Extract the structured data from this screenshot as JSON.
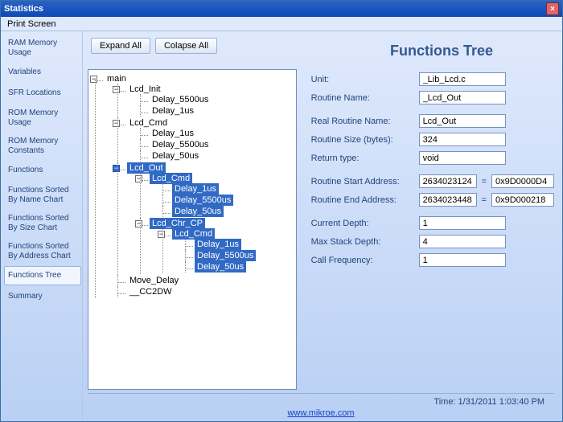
{
  "window": {
    "title": "Statistics",
    "close_glyph": "×"
  },
  "menu": {
    "print_screen": "Print Screen"
  },
  "sidebar": {
    "items": [
      {
        "label": "RAM Memory Usage"
      },
      {
        "label": "Variables"
      },
      {
        "label": "SFR Locations"
      },
      {
        "label": "ROM Memory Usage"
      },
      {
        "label": "ROM Memory Constants"
      },
      {
        "label": "Functions"
      },
      {
        "label": "Functions Sorted By Name Chart"
      },
      {
        "label": "Functions Sorted By Size Chart"
      },
      {
        "label": "Functions Sorted By Address Chart"
      },
      {
        "label": "Functions Tree"
      },
      {
        "label": "Summary"
      }
    ],
    "active_index": 9
  },
  "toolbar": {
    "expand": "Expand All",
    "collapse": "Colapse All"
  },
  "page": {
    "title": "Functions Tree"
  },
  "tree": {
    "root": "main",
    "lcd_init": "Lcd_Init",
    "d5500": "Delay_5500us",
    "d1": "Delay_1us",
    "d50": "Delay_50us",
    "lcd_cmd": "Lcd_Cmd",
    "lcd_out": "Lcd_Out",
    "lcd_chr_cp": "Lcd_Chr_CP",
    "move_delay": "Move_Delay",
    "cc2dw": "__CC2DW"
  },
  "props": {
    "unit_label": "Unit:",
    "unit": "_Lib_Lcd.c",
    "rname_label": "Routine Name:",
    "rname": "_Lcd_Out",
    "real_label": "Real Routine Name:",
    "real": "Lcd_Out",
    "size_label": "Routine Size (bytes):",
    "size": "324",
    "ret_label": "Return type:",
    "ret": "void",
    "start_label": "Routine Start Address:",
    "start_dec": "2634023124",
    "start_hex": "0x9D0000D4",
    "end_label": "Routine End Address:",
    "end_dec": "2634023448",
    "end_hex": "0x9D000218",
    "curdepth_label": "Current Depth:",
    "curdepth": "1",
    "maxdepth_label": "Max Stack Depth:",
    "maxdepth": "4",
    "freq_label": "Call Frequency:",
    "freq": "1",
    "eq": "="
  },
  "footer": {
    "time": "Time: 1/31/2011 1:03:40 PM",
    "link": "www.mikroe.com"
  }
}
